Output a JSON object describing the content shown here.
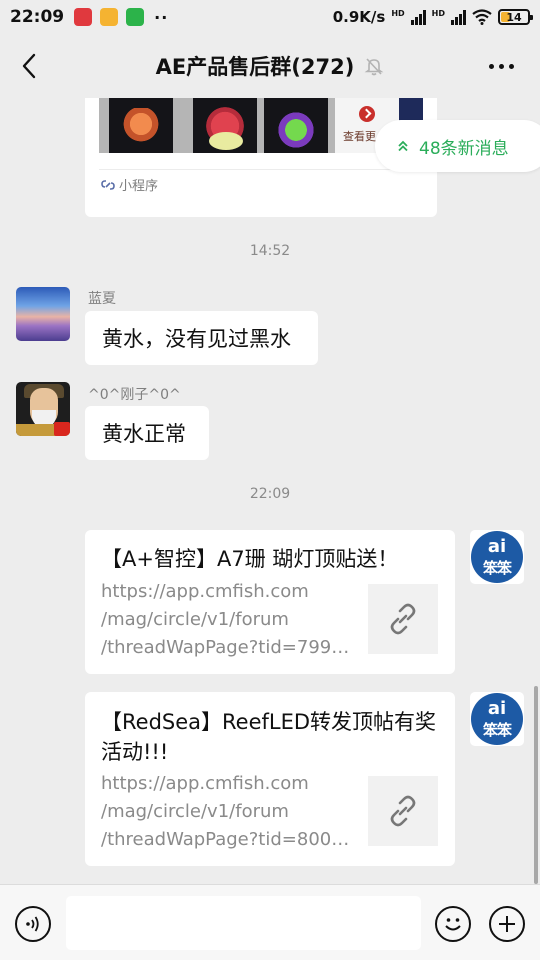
{
  "status_bar": {
    "time": "22:09",
    "dots": "··",
    "net_speed": "0.9K/s",
    "hd1": "HD",
    "hd2": "HD",
    "battery": "14"
  },
  "header": {
    "title": "AE产品售后群(272)"
  },
  "mini_program_card": {
    "more_label": "查看更",
    "source_label": "小程序"
  },
  "new_messages": {
    "label": "48条新消息",
    "accent": "#2bad5a"
  },
  "timestamps": [
    "14:52",
    "22:09"
  ],
  "messages": [
    {
      "sender": "蓝夏",
      "text": "黄水，没有见过黑水"
    },
    {
      "sender": "^0^刚子^0^",
      "text": "黄水正常"
    }
  ],
  "link_messages": [
    {
      "title": "【A+智控】A7珊 瑚灯顶贴送！",
      "url_lines": [
        "https://app.cmfish.com",
        "/mag/circle/v1/forum",
        "/threadWapPage?tid=799…"
      ],
      "avatar_text": {
        "top": "ai",
        "bottom": "笨笨"
      }
    },
    {
      "title": "【RedSea】ReefLED转发顶帖有奖活动!!!",
      "url_lines": [
        "https://app.cmfish.com",
        "/mag/circle/v1/forum",
        "/threadWapPage?tid=800…"
      ],
      "avatar_text": {
        "top": "ai",
        "bottom": "笨笨"
      }
    }
  ],
  "input_bar": {
    "placeholder": ""
  },
  "icons": [
    "back-arrow-icon",
    "mute-bell-icon",
    "more-dots-icon",
    "chevron-up-icon",
    "link-icon",
    "voice-icon",
    "emoji-icon",
    "plus-icon",
    "wifi-icon",
    "signal-icon",
    "battery-icon"
  ]
}
